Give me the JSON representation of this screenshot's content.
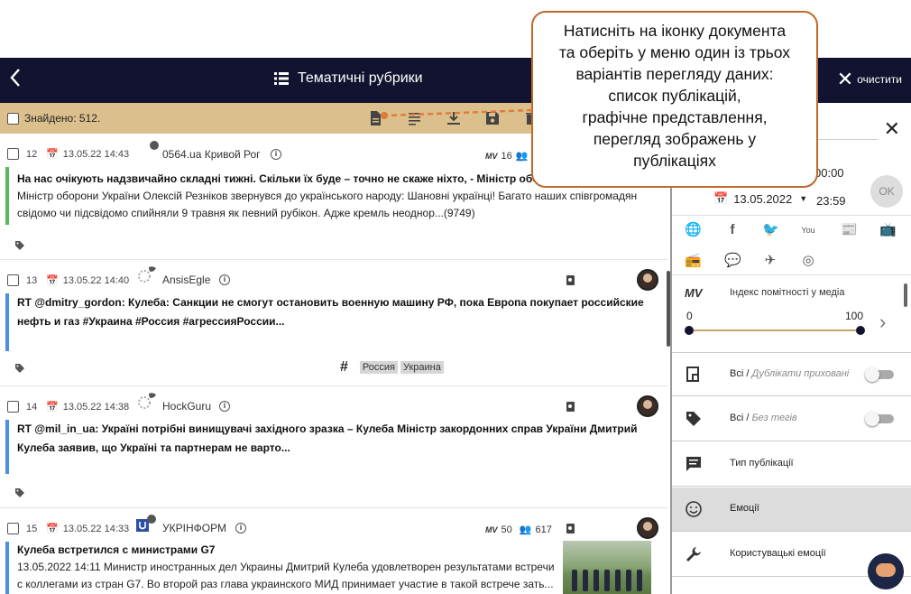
{
  "header": {
    "back_icon": "chevron-left-icon",
    "title": "Тематичні рубрики",
    "clear_label": "очистити"
  },
  "toolbar": {
    "found": "Знайдено: 512."
  },
  "publications": [
    {
      "num": "12",
      "date": "13.05.22 14:43",
      "source": "0564.ua Кривой Рог",
      "mv": "16",
      "bar_color": "#5cb85c",
      "title": "На нас очікують надзвичайно складні тижні. Скільки їх буде – точно не скаже ніхто, - Міністр оборон",
      "body": "Міністр оборони України Олексій Резніков звернувся до українського народу: Шановні українці! Багато наших співгромадян свідомо чи підсвідомо спийняли 9 травня як певний рубікон. Адже кремль неоднор...(9749)"
    },
    {
      "num": "13",
      "date": "13.05.22 14:40",
      "source": "AnsisEgle",
      "bar_color": "#4a90e2",
      "title": "RT @dmitry_gordon: Кулеба: Санкции не смогут остановить военную машину РФ, пока Европа покупает российские нефть и газ #Украина #Россия #агрессияРоссии...",
      "tags": [
        "Россия",
        "Украина"
      ]
    },
    {
      "num": "14",
      "date": "13.05.22 14:38",
      "source": "HockGuru",
      "bar_color": "#4a90e2",
      "title": "RT @mil_in_ua: Україні потрібні винищувачі західного зразка – Кулеба Міністр закордонних справ України Дмитрий Кулеба заявив, що Україні та партнерам не варто..."
    },
    {
      "num": "15",
      "date": "13.05.22 14:33",
      "source": "УКРІНФОРМ",
      "mv": "50",
      "audience": "617",
      "bar_color": "#4a90e2",
      "title": "Кулеба встретился с министрами G7",
      "body": "13.05.2022 14:11 Министр иностранных дел Украины Дмитрий Кулеба удовлетворен результатами встречи с коллегами из стран G7. Во второй раз глава украинского МИД принимает участие в такой встрече зать...(873)"
    }
  ],
  "panel": {
    "time_from": "00:00",
    "date_to": "13.05.2022",
    "time_to": "23:59",
    "ok_label": "OK",
    "mv_label": "MV",
    "mv_title": "Індекс помітності у медіа",
    "range_min": "0",
    "range_max": "100",
    "rows": [
      {
        "main": "Всі",
        "sub": "Дублікати приховані"
      },
      {
        "main": "Всі",
        "sub": "Без тегів"
      },
      {
        "main": "Тип публікації"
      },
      {
        "main": "Емоції"
      },
      {
        "main": "Користувацькі емоції"
      }
    ]
  },
  "callout": {
    "lines": [
      "Натисніть на іконку документа",
      "та оберіть у меню один із трьох",
      "варіантів перегляду даних:",
      "список публікацій,",
      "графічне представлення,",
      "перегляд зображень у",
      "публікаціях"
    ]
  },
  "colors": {
    "header_bg": "#121330",
    "toolbar_bg": "#dbbf8d",
    "callout_border": "#c0692b"
  }
}
